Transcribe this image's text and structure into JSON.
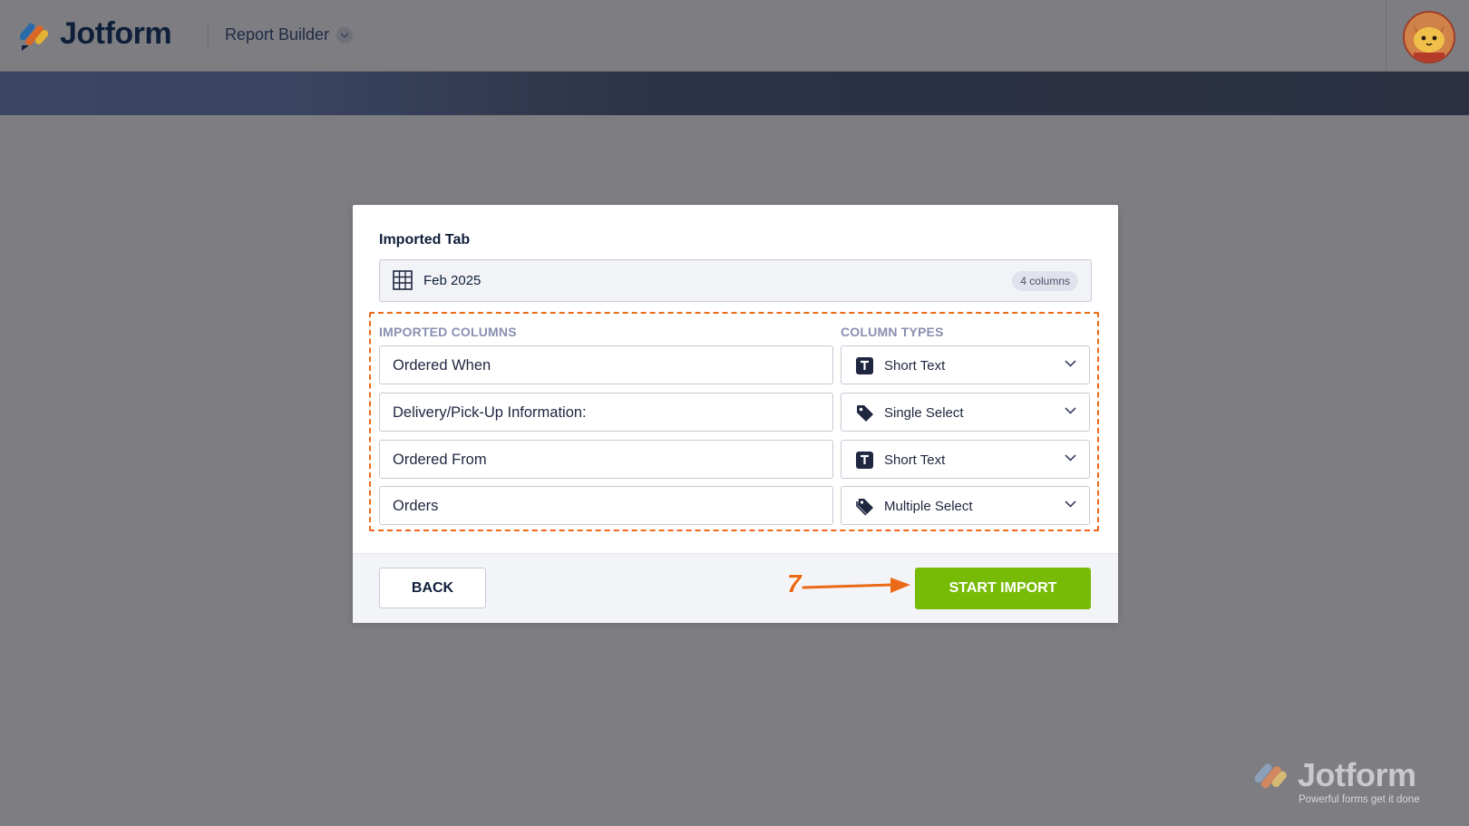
{
  "header": {
    "brand": "Jotform",
    "app_name": "Report Builder"
  },
  "dialog": {
    "tab_label": "Imported Tab",
    "tab_name": "Feb 2025",
    "column_count": "4 columns",
    "columns_header": "IMPORTED COLUMNS",
    "types_header": "COLUMN TYPES",
    "rows": [
      {
        "name": "Ordered When",
        "type": "Short Text",
        "type_icon": "text-type-icon"
      },
      {
        "name": "Delivery/Pick-Up Information:",
        "type": "Single Select",
        "type_icon": "tag-icon"
      },
      {
        "name": "Ordered From",
        "type": "Short Text",
        "type_icon": "text-type-icon"
      },
      {
        "name": "Orders",
        "type": "Multiple Select",
        "type_icon": "tags-icon"
      }
    ],
    "back_label": "BACK",
    "start_label": "START IMPORT"
  },
  "annotation": {
    "step": "7"
  },
  "watermark": {
    "brand": "Jotform",
    "tagline": "Powerful forms get it done"
  },
  "colors": {
    "accent_green": "#78bb07",
    "highlight_orange": "#ea6a17",
    "navy": "#0f1f3a"
  }
}
